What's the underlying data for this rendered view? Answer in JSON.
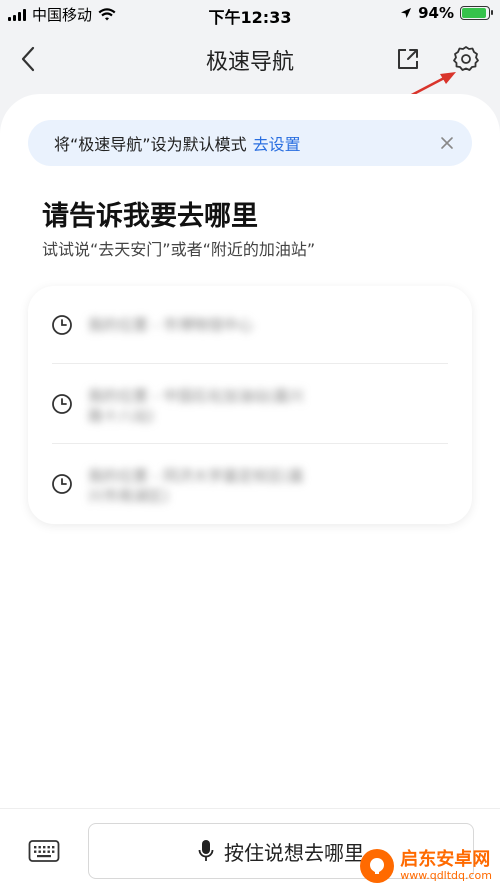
{
  "status": {
    "carrier": "中国移动",
    "time": "下午12:33",
    "battery": "94%",
    "battery_level": 0.94
  },
  "nav": {
    "title": "极速导航",
    "back_icon": "chevron-left-icon",
    "share_icon": "share-out-icon",
    "settings_icon": "gear-icon"
  },
  "banner": {
    "text": "将“极速导航”设为默认模式",
    "link": "去设置"
  },
  "prompt": {
    "title": "请告诉我要去哪里",
    "subtitle": "试试说“去天安门”或者“附近的加油站”"
  },
  "history": [
    {
      "text": "我的位置 - 市博物馆中心"
    },
    {
      "text": "我的位置 - 中国石化加油站(嘉兴路十八站)"
    },
    {
      "text": "我的位置 - 同济大学嘉定校区(嘉兴市南湖区)"
    }
  ],
  "bottom": {
    "voice_label": "按住说想去哪里"
  },
  "watermark": {
    "name": "启东安卓网",
    "url": "www.qdltdq.com"
  },
  "colors": {
    "accent": "#2a6fe0",
    "banner_bg": "#eaf2fd",
    "annotation_arrow": "#d9342b",
    "watermark": "#ff6a00"
  }
}
